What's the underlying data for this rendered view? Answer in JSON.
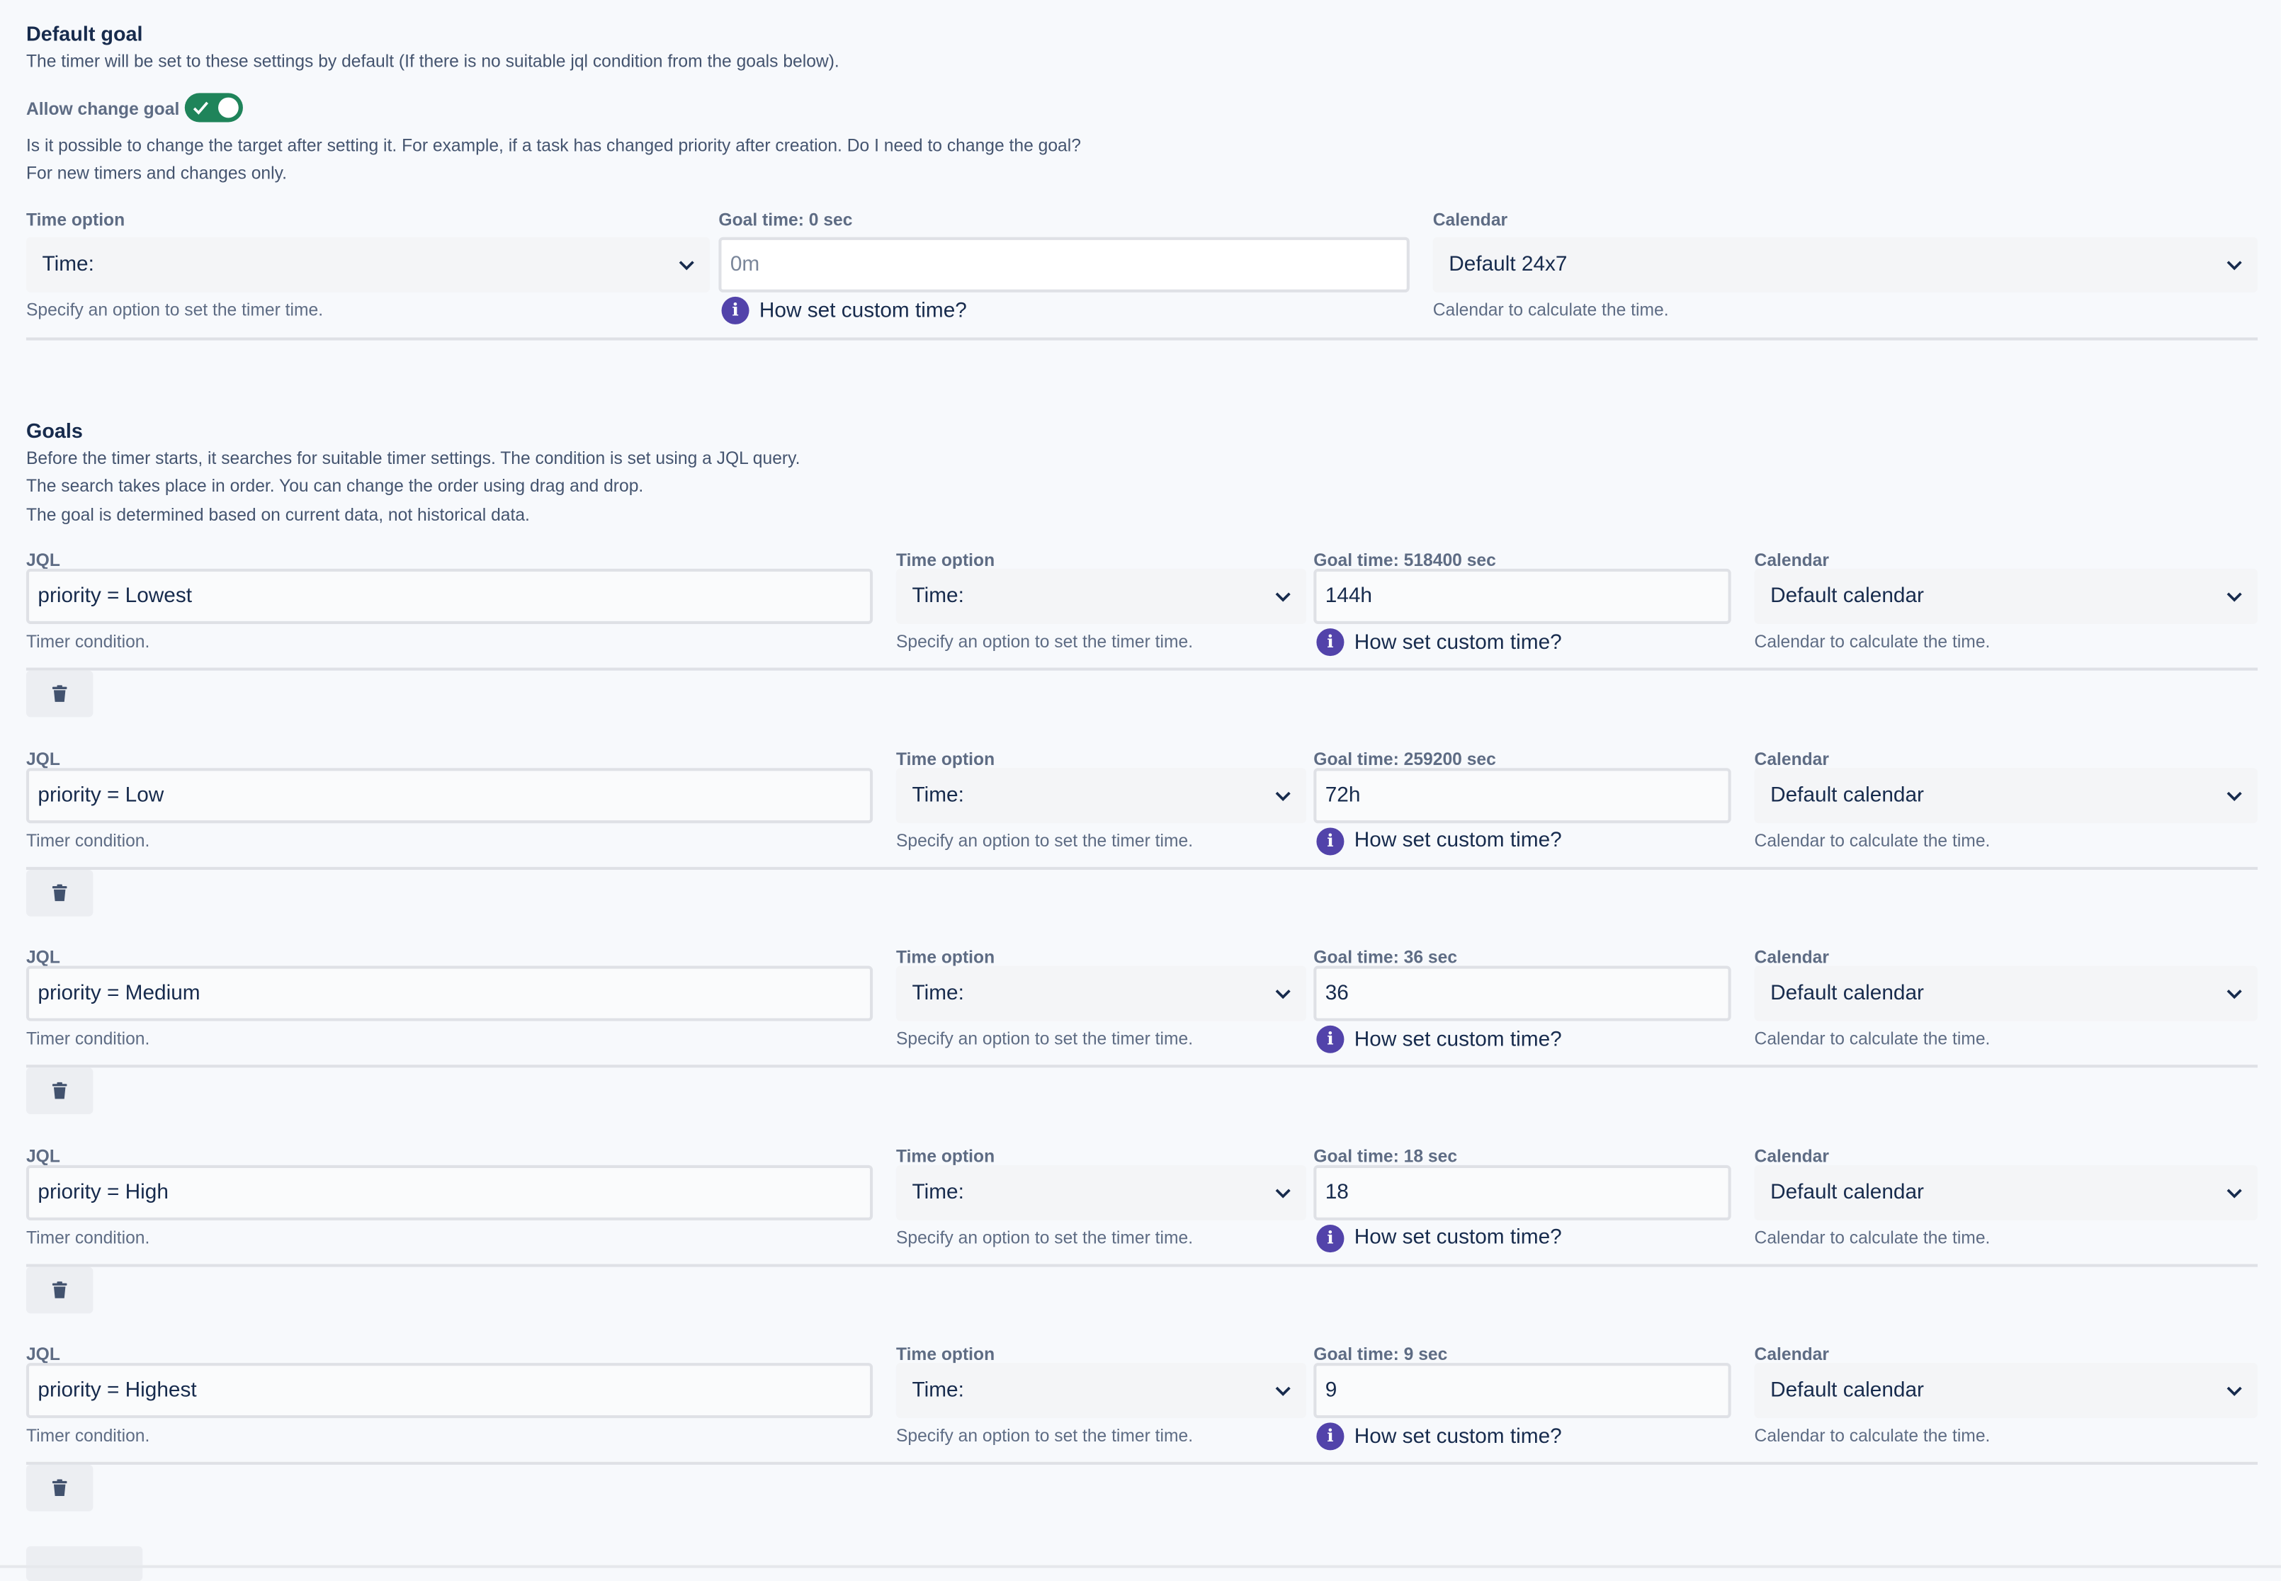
{
  "default_goal": {
    "title": "Default goal",
    "description": "The timer will be set to these settings by default (If there is no suitable jql condition from the goals below).",
    "allow_change": {
      "label": "Allow change goal",
      "enabled": true,
      "help": "Is it possible to change the target after setting it. For example, if a task has changed priority after creation. Do I need to change the goal?\nFor new timers and changes only."
    },
    "time_option": {
      "label": "Time option",
      "value": "Time:",
      "help": "Specify an option to set the timer time."
    },
    "goal_time": {
      "label": "Goal time: 0 sec",
      "placeholder": "0m",
      "link": "How set custom time?"
    },
    "calendar": {
      "label": "Calendar",
      "value": "Default 24x7",
      "help": "Calendar to calculate the time."
    }
  },
  "goals": {
    "title": "Goals",
    "description": "Before the timer starts, it searches for suitable timer settings. The condition is set using a JQL query.\nThe search takes place in order. You can change the order using drag and drop.\nThe goal is determined based on current data, not historical data.",
    "jql_label": "JQL",
    "jql_help": "Timer condition.",
    "time_option_label": "Time option",
    "time_option_value": "Time:",
    "time_option_help": "Specify an option to set the timer time.",
    "link": "How set custom time?",
    "calendar_label": "Calendar",
    "calendar_value": "Default calendar",
    "calendar_help": "Calendar to calculate the time.",
    "items": [
      {
        "jql": "priority = Lowest",
        "goal_label": "Goal time: 518400 sec",
        "goal_value": "144h"
      },
      {
        "jql": "priority = Low",
        "goal_label": "Goal time: 259200 sec",
        "goal_value": "72h"
      },
      {
        "jql": "priority = Medium",
        "goal_label": "Goal time: 36 sec",
        "goal_value": "36"
      },
      {
        "jql": "priority = High",
        "goal_label": "Goal time: 18 sec",
        "goal_value": "18"
      },
      {
        "jql": "priority = Highest",
        "goal_label": "Goal time: 9 sec",
        "goal_value": "9"
      }
    ]
  },
  "icons": {
    "chevron": "chevron-down-icon",
    "info": "info-icon",
    "trash": "trash-icon",
    "check": "check-icon"
  },
  "colors": {
    "toggle_on": "#1f845a",
    "info": "#5243aa",
    "background": "#f7f9fc"
  }
}
